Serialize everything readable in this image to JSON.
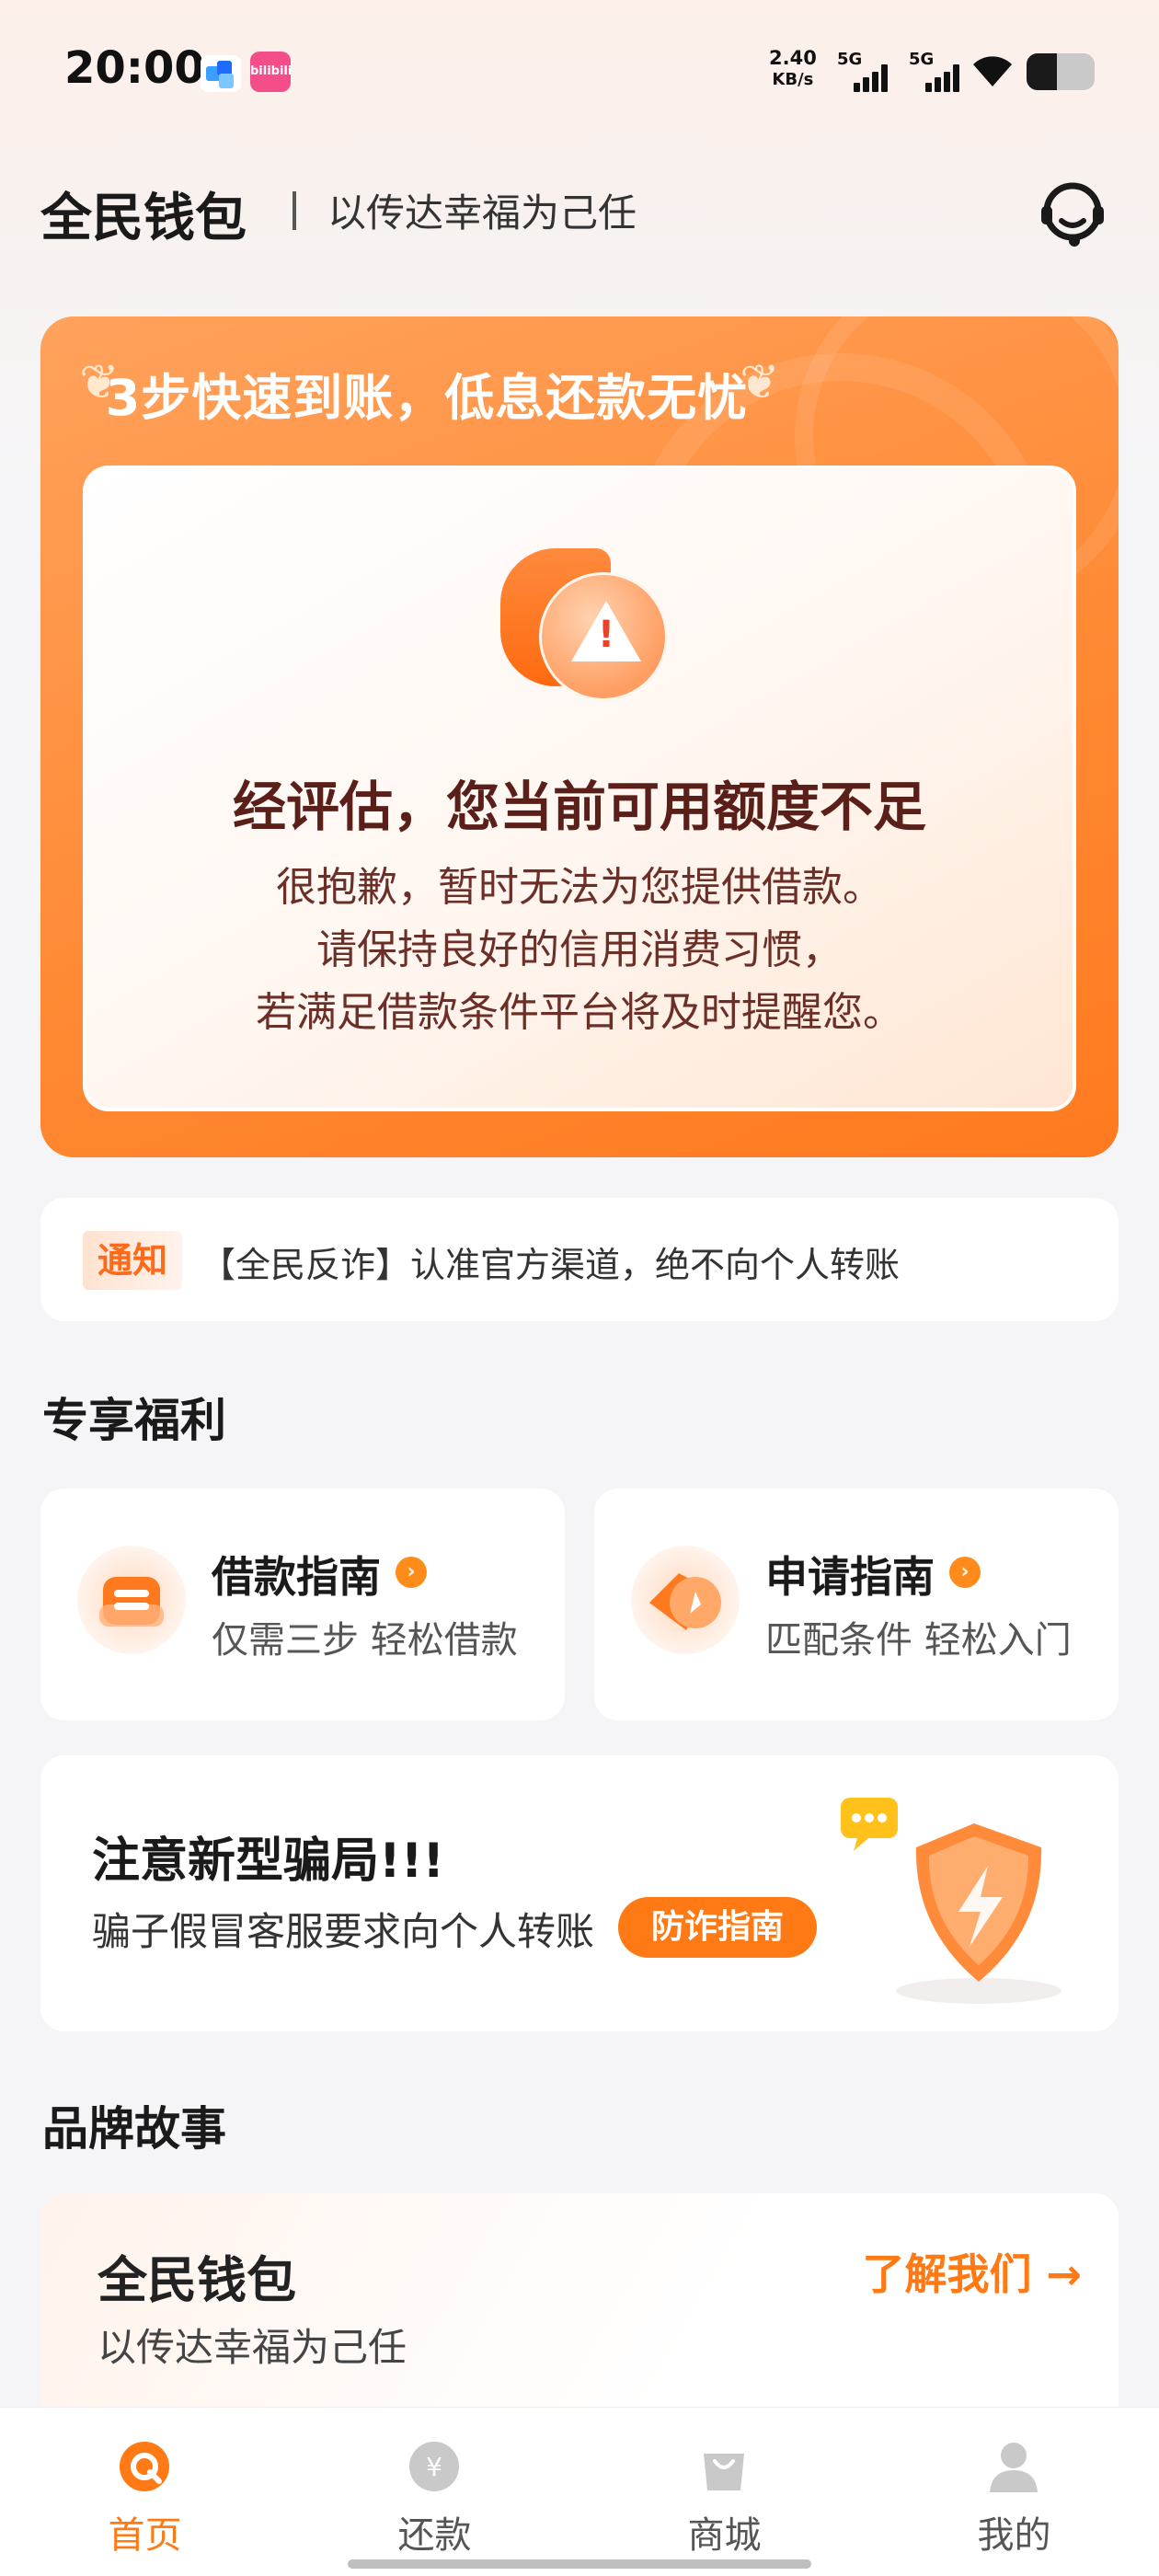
{
  "status_bar": {
    "time": "20:00",
    "app2_label": "bilibili",
    "net_speed_value": "2.40",
    "net_speed_unit": "KB/s",
    "sim1": "5G",
    "sim2": "5G",
    "battery_level": 0.45
  },
  "header": {
    "app_name": "全民钱包",
    "slogan": "以传达幸福为己任",
    "service_icon": "headset-icon"
  },
  "hero": {
    "slogan": "3步快速到账，低息还款无忧",
    "warning_icon": "warning-icon",
    "warning_mark": "!",
    "title": "经评估，您当前可用额度不足",
    "lines": [
      "很抱歉，暂时无法为您提供借款。",
      "请保持良好的信用消费习惯，",
      "若满足借款条件平台将及时提醒您。"
    ]
  },
  "notice": {
    "tag": "通知",
    "text": "【全民反诈】认准官方渠道，绝不向个人转账"
  },
  "benefits": {
    "title": "专享福利",
    "cards": [
      {
        "title": "借款指南",
        "subtitle": "仅需三步 轻松借款",
        "icon": "loan-guide-icon"
      },
      {
        "title": "申请指南",
        "subtitle": "匹配条件 轻松入门",
        "icon": "compass-icon"
      }
    ],
    "arrow": "›"
  },
  "fraud": {
    "title": "注意新型骗局!!!",
    "desc": "骗子假冒客服要求向个人转账",
    "button": "防诈指南",
    "icon": "shield-icon"
  },
  "brand": {
    "section_title": "品牌故事",
    "name": "全民钱包",
    "slogan": "以传达幸福为己任",
    "link": "了解我们 →"
  },
  "bottom_nav": [
    {
      "label": "首页",
      "icon": "home-icon",
      "active": true
    },
    {
      "label": "还款",
      "icon": "repay-icon",
      "active": false
    },
    {
      "label": "商城",
      "icon": "shop-icon",
      "active": false
    },
    {
      "label": "我的",
      "icon": "profile-icon",
      "active": false
    }
  ],
  "colors": {
    "accent": "#ff7a14",
    "hero_start": "#ffa25c",
    "hero_end": "#ff7a1f",
    "title_dark": "#5b1f1a"
  }
}
